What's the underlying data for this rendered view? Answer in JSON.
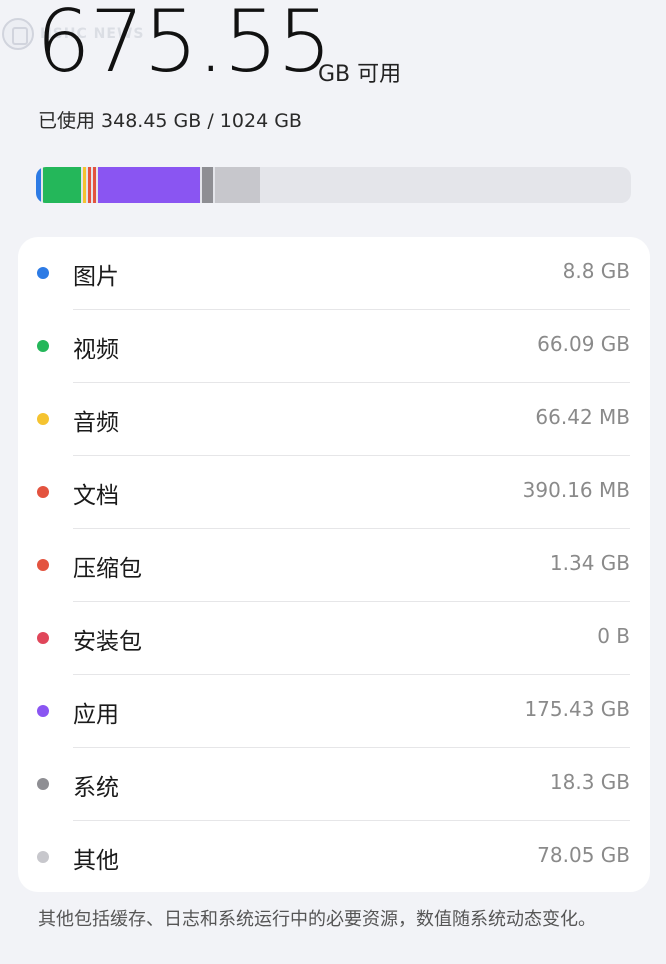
{
  "watermark": {
    "text": "HSHC NEWS"
  },
  "header": {
    "available_value": "675.55",
    "available_unit": "GB 可用",
    "used_text": "已使用 348.45 GB / 1024 GB"
  },
  "usage_bar": {
    "track_color": "#e4e5ea",
    "segments": [
      {
        "name": "图片",
        "fraction": 0.0086,
        "color": "#2d7be5"
      },
      {
        "name": "视频",
        "fraction": 0.0645,
        "color": "#24b75a"
      },
      {
        "name": "音频",
        "fraction": 6e-05,
        "color": "#f5c330"
      },
      {
        "name": "文档",
        "fraction": 0.0004,
        "color": "#e3533f"
      },
      {
        "name": "压缩包",
        "fraction": 0.0013,
        "color": "#e3533f"
      },
      {
        "name": "安装包",
        "fraction": 0.0,
        "color": "#e0465a"
      },
      {
        "name": "应用",
        "fraction": 0.1713,
        "color": "#8a55f2"
      },
      {
        "name": "系统",
        "fraction": 0.0179,
        "color": "#8e8e93"
      },
      {
        "name": "其他",
        "fraction": 0.0762,
        "color": "#c7c7cc"
      }
    ]
  },
  "categories": [
    {
      "label": "图片",
      "value": "8.8 GB",
      "color": "#2d7be5"
    },
    {
      "label": "视频",
      "value": "66.09 GB",
      "color": "#24b75a"
    },
    {
      "label": "音频",
      "value": "66.42 MB",
      "color": "#f5c330"
    },
    {
      "label": "文档",
      "value": "390.16 MB",
      "color": "#e3533f"
    },
    {
      "label": "压缩包",
      "value": "1.34 GB",
      "color": "#e3533f"
    },
    {
      "label": "安装包",
      "value": "0 B",
      "color": "#e0465a"
    },
    {
      "label": "应用",
      "value": "175.43 GB",
      "color": "#8a55f2"
    },
    {
      "label": "系统",
      "value": "18.3 GB",
      "color": "#8e8e93"
    },
    {
      "label": "其他",
      "value": "78.05 GB",
      "color": "#c7c7cc"
    }
  ],
  "footnote": "其他包括缓存、日志和系统运行中的必要资源，数值随系统动态变化。"
}
